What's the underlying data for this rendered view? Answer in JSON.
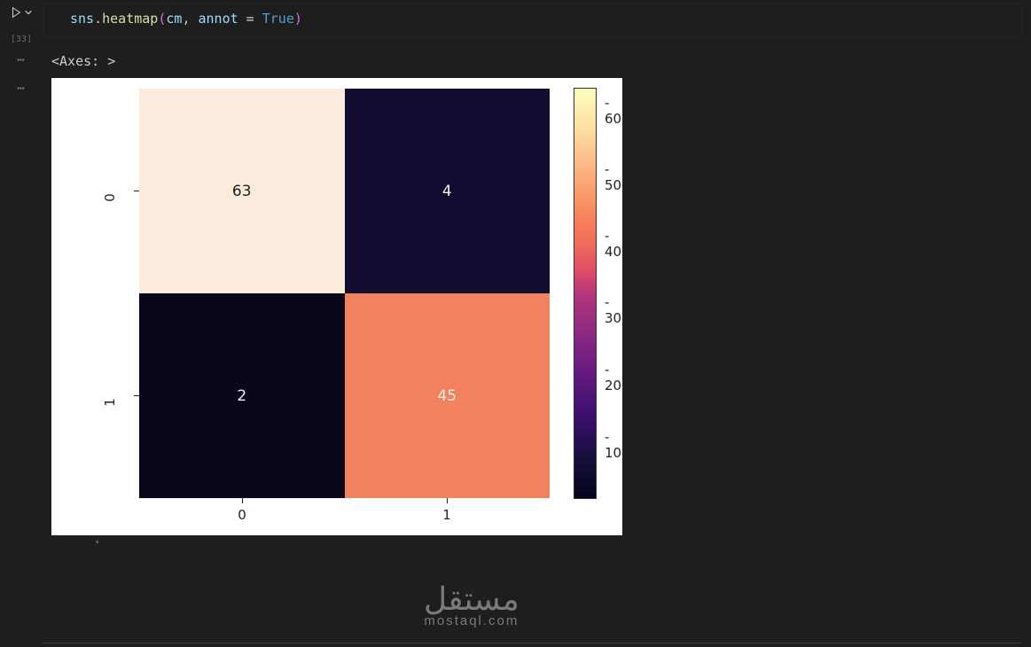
{
  "cell": {
    "exec_count": "[33]",
    "code": {
      "obj": "sns",
      "dot": ".",
      "func": "heatmap",
      "lparen": "(",
      "arg1": "cm",
      "comma": ", ",
      "param": "annot",
      "eq": " = ",
      "bool": "True",
      "rparen": ")"
    }
  },
  "output": {
    "text": "<Axes: >"
  },
  "chart_data": {
    "type": "heatmap",
    "x_categories": [
      "0",
      "1"
    ],
    "y_categories": [
      "0",
      "1"
    ],
    "values": [
      [
        63,
        4
      ],
      [
        2,
        45
      ]
    ],
    "colorbar": {
      "ticks": [
        10,
        20,
        30,
        40,
        50,
        60
      ],
      "range": [
        2,
        63
      ]
    },
    "annot": true
  },
  "watermark": {
    "top": "مستقل",
    "bottom": "mostaql.com"
  },
  "scroll_indicator": "◂"
}
